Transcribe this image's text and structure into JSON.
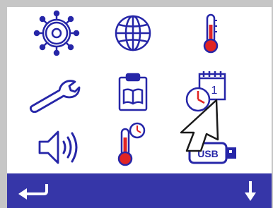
{
  "colors": {
    "frame": "#c6c6c6",
    "screen": "#ffffff",
    "bar": "#3636a8",
    "icon_blue": "#2626a8",
    "accent_red": "#e02424"
  },
  "menu": {
    "items": [
      {
        "name": "ship-wheel",
        "icon": "ship-wheel-icon"
      },
      {
        "name": "globe",
        "icon": "globe-icon"
      },
      {
        "name": "thermometer",
        "icon": "thermometer-icon"
      },
      {
        "name": "wrench",
        "icon": "wrench-icon"
      },
      {
        "name": "clipboard-book",
        "icon": "clipboard-book-icon"
      },
      {
        "name": "clock-calendar",
        "icon": "clock-calendar-icon",
        "calendar_day": "1"
      },
      {
        "name": "speaker",
        "icon": "speaker-volume-icon"
      },
      {
        "name": "thermometer-timer",
        "icon": "thermometer-clock-icon"
      },
      {
        "name": "usb",
        "icon": "usb-drive-icon",
        "label": "USB"
      }
    ]
  },
  "bottom_bar": {
    "back_icon": "return-arrow-icon",
    "down_icon": "down-arrow-icon"
  },
  "pointer": {
    "icon": "pointer-arrow-icon"
  }
}
